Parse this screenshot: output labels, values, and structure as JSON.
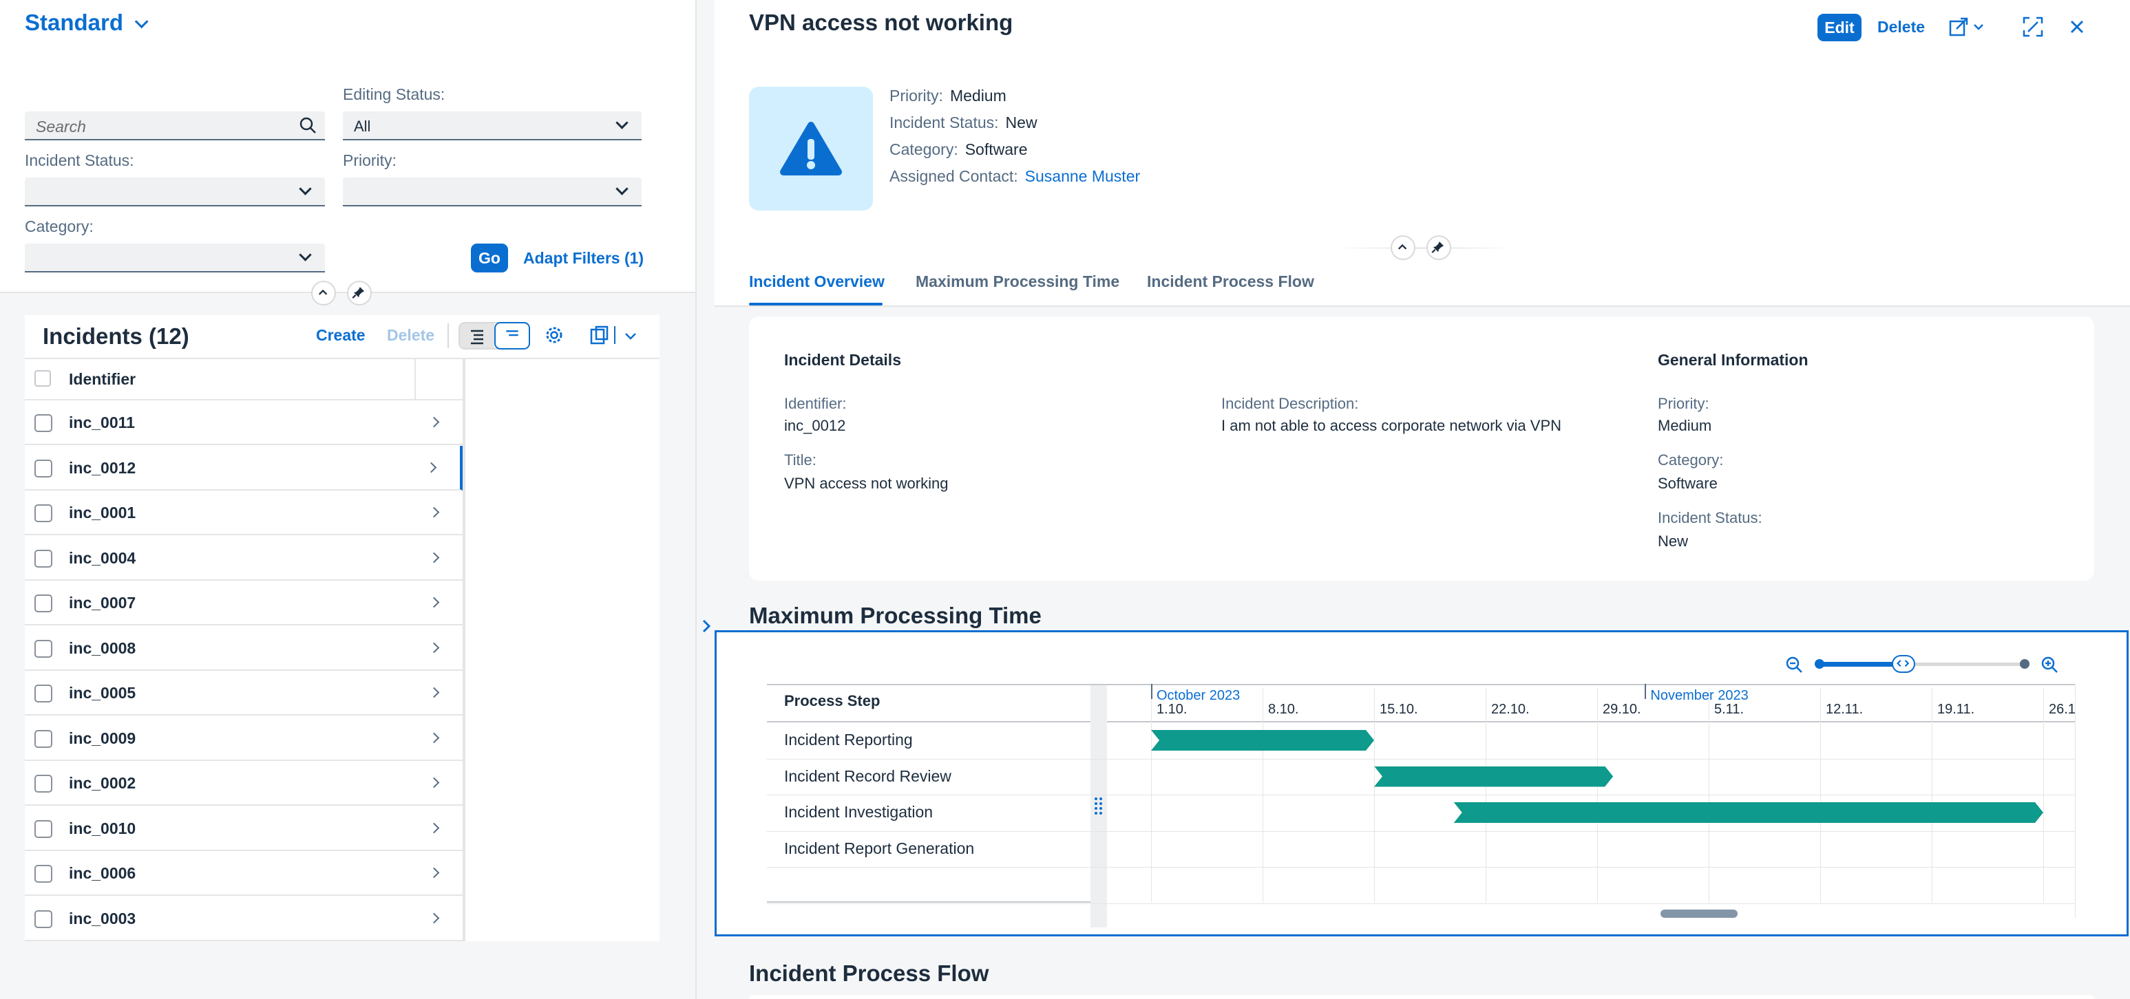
{
  "left": {
    "variant": "Standard",
    "filters": {
      "search_placeholder": "Search",
      "editing_status_label": "Editing Status:",
      "editing_status_value": "All",
      "incident_status_label": "Incident Status:",
      "priority_label": "Priority:",
      "category_label": "Category:",
      "go": "Go",
      "adapt": "Adapt Filters (1)"
    },
    "table": {
      "title": "Incidents (12)",
      "create": "Create",
      "delete": "Delete",
      "column": "Identifier",
      "rows": [
        "inc_0011",
        "inc_0012",
        "inc_0001",
        "inc_0004",
        "inc_0007",
        "inc_0008",
        "inc_0005",
        "inc_0009",
        "inc_0002",
        "inc_0010",
        "inc_0006",
        "inc_0003"
      ],
      "selected_row": "inc_0012"
    }
  },
  "object": {
    "title": "VPN access not working",
    "edit": "Edit",
    "delete": "Delete",
    "attrs": {
      "priority_label": "Priority:",
      "priority": "Medium",
      "status_label": "Incident Status:",
      "status": "New",
      "category_label": "Category:",
      "category": "Software",
      "contact_label": "Assigned Contact:",
      "contact": "Susanne Muster"
    },
    "tabs": [
      "Incident Overview",
      "Maximum Processing Time",
      "Incident Process Flow"
    ],
    "details": {
      "title": "Incident Details",
      "identifier_label": "Identifier:",
      "identifier": "inc_0012",
      "title_label": "Title:",
      "title_value": "VPN access not working",
      "description_label": "Incident Description:",
      "description": "I am not able to access corporate network via VPN"
    },
    "general": {
      "title": "General Information",
      "priority_label": "Priority:",
      "priority": "Medium",
      "category_label": "Category:",
      "category": "Software",
      "status_label": "Incident Status:",
      "status": "New"
    },
    "section_mpt": "Maximum Processing Time",
    "section_flow": "Incident Process Flow",
    "gantt": {
      "column": "Process Step",
      "months": [
        "October 2023",
        "November 2023"
      ],
      "ticks": [
        "1.10.",
        "8.10.",
        "15.10.",
        "22.10.",
        "29.10.",
        "5.11.",
        "12.11.",
        "19.11.",
        "26.1"
      ],
      "steps": [
        "Incident Reporting",
        "Incident Record Review",
        "Incident Investigation",
        "Incident Report Generation"
      ],
      "bars": [
        {
          "step": "Incident Reporting",
          "start": "2023-10-01",
          "end": "2023-10-15"
        },
        {
          "step": "Incident Record Review",
          "start": "2023-10-15",
          "end": "2023-10-30"
        },
        {
          "step": "Incident Investigation",
          "start": "2023-10-20",
          "end": "2023-11-26"
        }
      ],
      "color": "#0e9a8c"
    }
  },
  "colors": {
    "accent": "#0a6ed1",
    "bar": "#0e9a8c"
  }
}
